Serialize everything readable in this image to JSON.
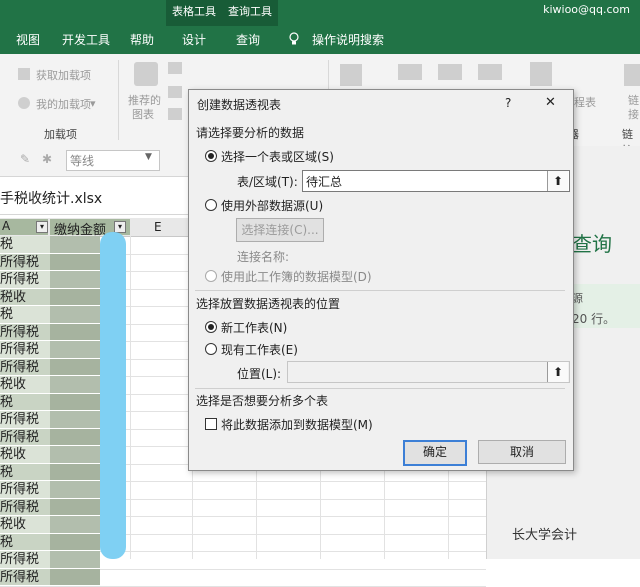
{
  "titlebar": {
    "context_tab_table": "表格工具",
    "context_tab_query": "查询工具",
    "user": "kiwioo@qq.com"
  },
  "tabs": [
    "视图",
    "开发工具",
    "帮助",
    "设计",
    "查询",
    "操作说明搜索"
  ],
  "ribbon": {
    "get_addins": "获取加载项",
    "my_addins": "我的加载项",
    "addins_group": "加载项",
    "recommended_1": "推荐的",
    "recommended_2": "图表",
    "partial_right": "程表",
    "partial_right2": "链",
    "partial_right3": "接",
    "group_tail": "器",
    "link_group": "链接"
  },
  "formula_row": {
    "line_style": "等线"
  },
  "file": {
    "name": "手税收统计.xlsx"
  },
  "sheet": {
    "col_a": "A",
    "col_b": "缴纳金额",
    "col_e": "E",
    "rows": [
      "税",
      "所得税",
      "所得税",
      "税收",
      "税",
      "所得税",
      "所得税",
      "所得税",
      "税收",
      "税",
      "所得税",
      "所得税",
      "税收",
      "税",
      "所得税",
      "所得税",
      "税收",
      "税",
      "所得税",
      "所得税"
    ]
  },
  "pane": {
    "title": "查询",
    "line1": "源",
    "line2": "20 行。"
  },
  "dialog": {
    "title": "创建数据透视表",
    "help": "?",
    "close": "✕",
    "section_data": "请选择要分析的数据",
    "opt_range": "选择一个表或区域(S)",
    "range_label": "表/区域(T):",
    "range_value": "待汇总",
    "opt_external": "使用外部数据源(U)",
    "choose_conn": "选择连接(C)...",
    "conn_name": "连接名称:",
    "opt_model": "使用此工作簿的数据模型(D)",
    "section_place": "选择放置数据透视表的位置",
    "opt_new": "新工作表(N)",
    "opt_existing": "现有工作表(E)",
    "location_label": "位置(L):",
    "location_value": "",
    "section_multi": "选择是否想要分析多个表",
    "add_model": "将此数据添加到数据模型(M)",
    "ok": "确定",
    "cancel": "取消"
  },
  "watermark": "长大学会计"
}
